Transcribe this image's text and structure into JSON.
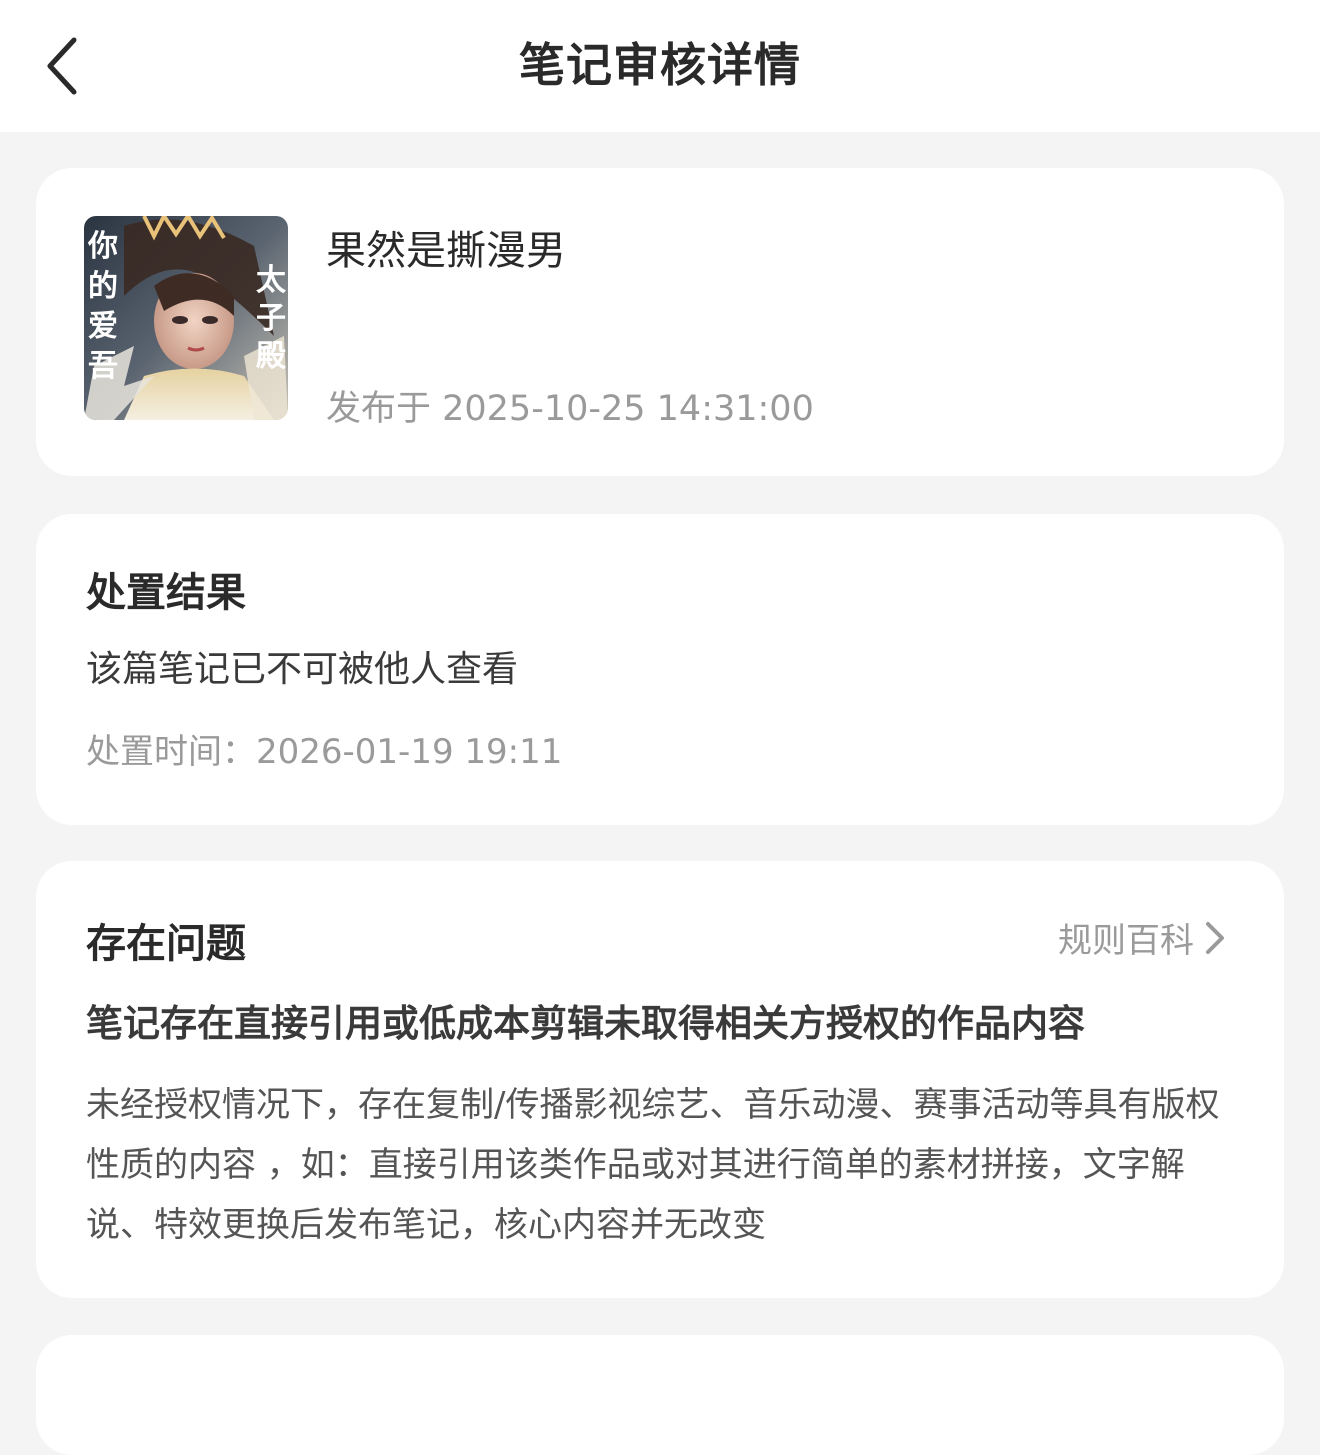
{
  "header": {
    "title": "笔记审核详情",
    "back_icon": "chevron-left-icon"
  },
  "note": {
    "title": "果然是撕漫男",
    "publish_time": "发布于 2025-10-25 14:31:00",
    "cover_text_left": "你的爱吾",
    "cover_text_right": "太子殿"
  },
  "result": {
    "title": "处置结果",
    "text": "该篇笔记已不可被他人查看",
    "time": "处置时间：2026-01-19 19:11"
  },
  "issue": {
    "title": "存在问题",
    "rules_link": "规则百科",
    "headline": "笔记存在直接引用或低成本剪辑未取得相关方授权的作品内容",
    "description": "未经授权情况下，存在复制/传播影视综艺、音乐动漫、赛事活动等具有版权性质的内容 ，如：直接引用该类作品或对其进行简单的素材拼接，文字解说、特效更换后发布笔记，核心内容并无改变"
  },
  "colors": {
    "background": "#f4f4f4",
    "card": "#ffffff",
    "primary_text": "#2a2a2a",
    "secondary_text": "#9a9a9a"
  }
}
